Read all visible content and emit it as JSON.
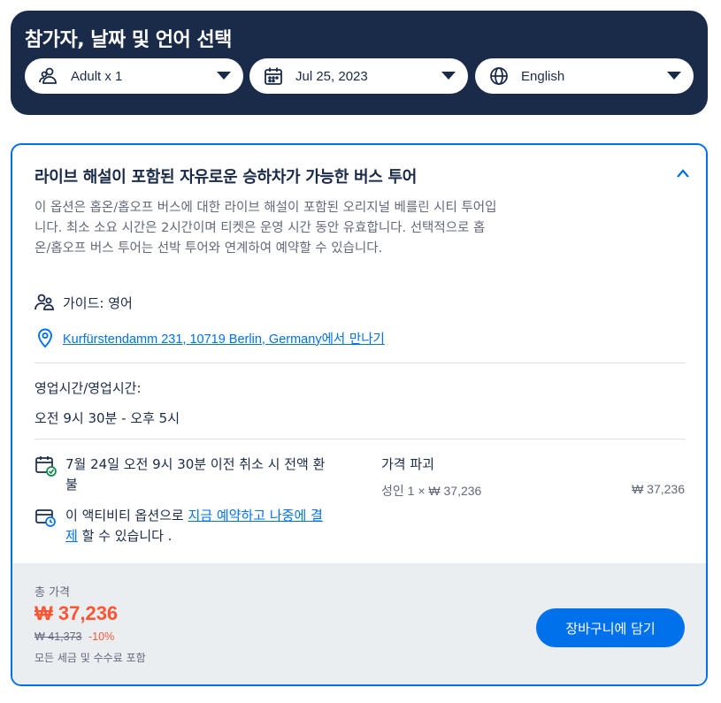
{
  "header": {
    "title": "참가자, 날짜 및 언어 선택",
    "participants": {
      "label": "Adult x 1",
      "icon": "people-icon"
    },
    "date": {
      "label": "Jul 25, 2023",
      "icon": "calendar-icon"
    },
    "language": {
      "label": "English",
      "icon": "globe-icon"
    }
  },
  "option": {
    "title": "라이브 해설이 포함된 자유로운 승하차가 가능한 버스 투어",
    "description": "이 옵션은 홉온/홉오프 버스에 대한 라이브 해설이 포함된 오리지널 베를린 시티 투어입니다. 최소 소요 시간은 2시간이며 티켓은 운영 시간 동안 유효합니다. 선택적으로 홉온/홉오프 버스 투어는 선박 투어와 연계하여 예약할 수 있습니다.",
    "guide": "가이드: 영어",
    "meeting_address": "Kurfürstendamm 231, 10719 Berlin, Germany",
    "meeting_suffix": "에서 만나기",
    "hours_label": "영업시간/영업시간:",
    "hours_value": "오전 9시 30분 - 오후 5시",
    "cancellation": "7월 24일 오전 9시 30분 이전 취소 시 전액 환불",
    "pay_prefix": "이 액티비티 옵션으로 ",
    "pay_link": "지금 예약하고 나중에 결제",
    "pay_suffix": " 할 수 있습니다 .",
    "price_breakdown_title": "가격 파괴",
    "price_line": "성인 1 × ₩ 37,236",
    "price_line_amount": "₩ 37,236"
  },
  "footer": {
    "total_label": "총 가격",
    "total_price": "₩ 37,236",
    "original_price": "₩ 41,373",
    "discount": "-10%",
    "tax_note": "모든 세금 및 수수료 포함",
    "cart_button": "장바구니에 담기"
  },
  "colors": {
    "header_bg": "#1a2b49",
    "accent": "#0071eb",
    "price": "#ff5533",
    "footer_bg": "#ebeef1"
  }
}
